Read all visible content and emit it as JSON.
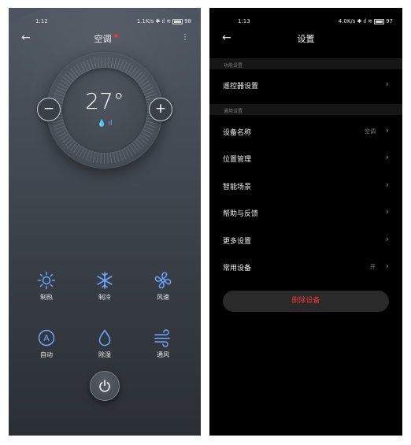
{
  "left_screen": {
    "status_bar": {
      "time": "1:12",
      "speed": "1.1K/s",
      "battery": "98"
    },
    "title": "空调",
    "temperature": "27°",
    "temp_icons": "💧 ıl",
    "minus_label": "−",
    "plus_label": "+",
    "modes": [
      {
        "label": "制热",
        "icon": "sun-icon"
      },
      {
        "label": "制冷",
        "icon": "snowflake-icon"
      },
      {
        "label": "风速",
        "icon": "fan-icon"
      },
      {
        "label": "自动",
        "icon": "auto-icon"
      },
      {
        "label": "除湿",
        "icon": "droplet-icon"
      },
      {
        "label": "通风",
        "icon": "wind-icon"
      }
    ],
    "icon_color": "#6fa3ff"
  },
  "right_screen": {
    "status_bar": {
      "time": "1:13",
      "speed": "4.0K/s",
      "battery": "97"
    },
    "title": "设置",
    "section1_label": "功能设置",
    "section2_label": "通用设置",
    "rows": [
      {
        "label": "遥控器设置",
        "value": ""
      },
      {
        "label": "设备名称",
        "value": "空调"
      },
      {
        "label": "位置管理",
        "value": ""
      },
      {
        "label": "智能场景",
        "value": ""
      },
      {
        "label": "帮助与反馈",
        "value": ""
      },
      {
        "label": "更多设置",
        "value": ""
      },
      {
        "label": "常用设备",
        "value": "开"
      }
    ],
    "delete_label": "删除设备",
    "delete_color": "#e53935"
  }
}
